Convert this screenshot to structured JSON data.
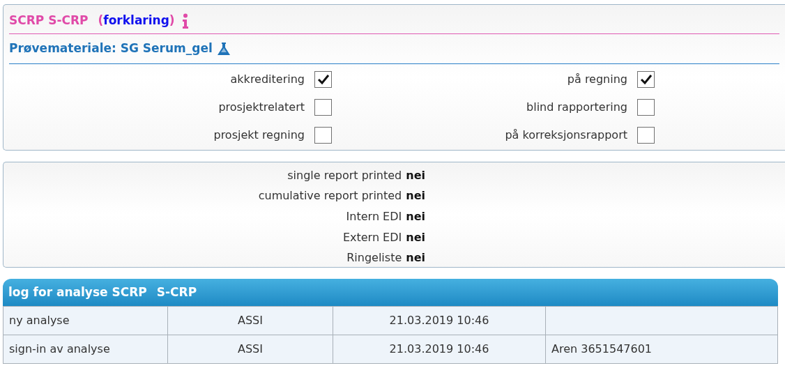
{
  "header": {
    "title": "SCRP S-CRP",
    "link_open": "(",
    "link": "forklaring",
    "link_close": ")"
  },
  "material": {
    "label": "Prøvemateriale: SG Serum_gel"
  },
  "flags": [
    {
      "label": "akkreditering",
      "checked": true
    },
    {
      "label": "på regning",
      "checked": true
    },
    {
      "label": "prosjektrelatert",
      "checked": false
    },
    {
      "label": "blind rapportering",
      "checked": false
    },
    {
      "label": "prosjekt regning",
      "checked": false
    },
    {
      "label": "på korreksjonsrapport",
      "checked": false
    }
  ],
  "reports": [
    {
      "label": "single report printed",
      "value": "nei"
    },
    {
      "label": "cumulative report printed",
      "value": "nei"
    },
    {
      "label": "Intern EDI",
      "value": "nei"
    },
    {
      "label": "Extern EDI",
      "value": "nei"
    },
    {
      "label": "Ringeliste",
      "value": "nei"
    }
  ],
  "log": {
    "title": "log for analyse SCRP",
    "analysis": "S-CRP",
    "rows": [
      [
        "ny analyse",
        "ASSI",
        "21.03.2019 10:46",
        ""
      ],
      [
        "sign-in av analyse",
        "ASSI",
        "21.03.2019 10:46",
        "Aren 3651547601"
      ]
    ]
  }
}
